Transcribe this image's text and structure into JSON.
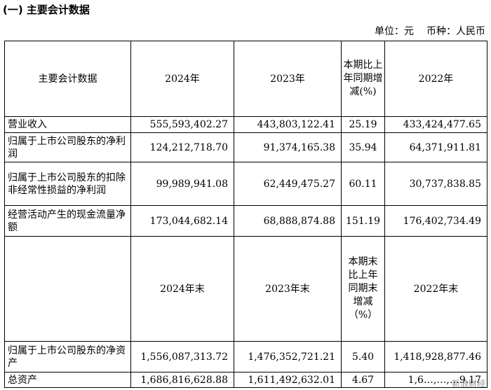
{
  "section_title": "(一) 主要会计数据",
  "unit_line": {
    "unit": "单位：元",
    "currency": "币种：人民币"
  },
  "table": {
    "header1": {
      "item": "主要会计数据",
      "y2024": "2024年",
      "y2023": "2023年",
      "change": "本期比上年同期增减(%)",
      "y2022": "2022年"
    },
    "rows1": [
      {
        "label": "营业收入",
        "v2024": "555,593,402.27",
        "v2023": "443,803,122.41",
        "change": "25.19",
        "v2022": "433,424,477.65"
      },
      {
        "label": "归属于上市公司股东的净利润",
        "v2024": "124,212,718.70",
        "v2023": "91,374,165.38",
        "change": "35.94",
        "v2022": "64,371,911.81"
      },
      {
        "label": "归属于上市公司股东的扣除非经常性损益的净利润",
        "v2024": "99,989,941.08",
        "v2023": "62,449,475.27",
        "change": "60.11",
        "v2022": "30,737,838.85"
      },
      {
        "label": "经营活动产生的现金流量净额",
        "v2024": "173,044,682.14",
        "v2023": "68,888,874.88",
        "change": "151.19",
        "v2022": "176,402,734.49"
      }
    ],
    "header2": {
      "item": "",
      "y2024": "2024年末",
      "y2023": "2023年末",
      "change": "本期末比上年同期末增减（%）",
      "y2022": "2022年末"
    },
    "rows2": [
      {
        "label": "归属于上市公司股东的净资产",
        "v2024": "1,556,087,313.72",
        "v2023": "1,476,352,721.21",
        "change": "5.40",
        "v2022": "1,418,928,877.46"
      },
      {
        "label": "总资产",
        "v2024": "1,686,816,628.88",
        "v2023": "1,611,492,632.01",
        "change": "4.67",
        "v2022": "1,6…,…,…9.17"
      }
    ]
  },
  "watermark": "新浪财经"
}
